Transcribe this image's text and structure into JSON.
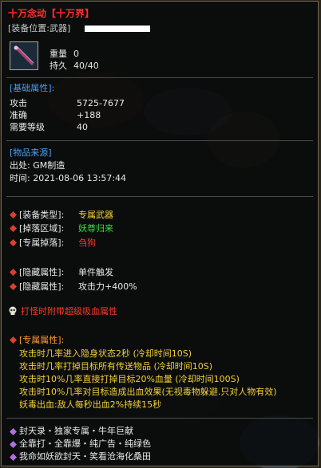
{
  "item": {
    "title": "十万念动【十万界】",
    "slot_label": "[装备位置:武器]",
    "weight_label": "重量",
    "weight_value": "0",
    "durability_label": "持久",
    "durability_value": "40/40"
  },
  "base": {
    "header": "[基础属性]:",
    "rows": [
      {
        "label": "攻击",
        "value": "5725-7677"
      },
      {
        "label": "准确",
        "value": "+188"
      },
      {
        "label": "需要等级",
        "value": "40"
      }
    ]
  },
  "source": {
    "header": "[物品来源]",
    "from": "出处: GM制造",
    "time": "时间: 2021-08-06 13:57:44"
  },
  "equip_info": [
    {
      "label": "[装备类型]:",
      "value": "专属武器"
    },
    {
      "label": "[掉落区域]:",
      "value": "妖尊归来"
    },
    {
      "label": "[专属掉落]:",
      "value": "刍狗"
    }
  ],
  "hidden": [
    {
      "label": "[隐藏属性]:",
      "value": "单件触发"
    },
    {
      "label": "[隐藏属性]:",
      "value": "攻击力+400%"
    }
  ],
  "special_line": "打怪时附带超级吸血属性",
  "exclusive": {
    "header": "[专属属性]:",
    "lines": [
      "攻击时几率进入隐身状态2秒 (冷却时间10S)",
      "攻击时几率打掉目标所有传送物品 (冷却时间10S)",
      "攻击时10%几率直接打掉目标20%血量 (冷却时间100S)",
      "攻击时10%几率对目标造成出血效果(无视毒物躲避.只对人物有效)",
      "妖毒出血:敌人每秒出血2%持续15秒"
    ]
  },
  "footer": [
    "封天录・独家专属・牛年巨献",
    "全靠打・全靠爆・纯广告・纯绿色",
    "我命如妖欲封天・笑看沧海化桑田"
  ],
  "colors": {
    "title": "#ff2c2c",
    "header": "#4aa0f0",
    "yellow": "#f2d13a",
    "green": "#39e239",
    "red": "#ff3a2a",
    "orange": "#ff9c2a"
  }
}
